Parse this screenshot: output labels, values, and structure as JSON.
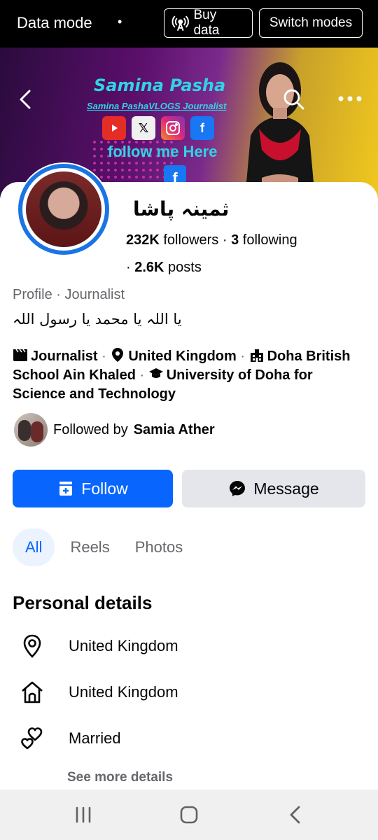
{
  "status_bar": {
    "mode_label": "Data mode",
    "buy_data_label": "Buy data",
    "switch_modes_label": "Switch modes"
  },
  "cover": {
    "title": "Samina Pasha",
    "subtitle": "Samina PashaVLOGS Journalist",
    "follow_text": "follow me Here",
    "social_icons": [
      "youtube-icon",
      "x-icon",
      "instagram-icon",
      "facebook-icon"
    ]
  },
  "profile": {
    "name": "ثمینہ پاشا",
    "followers_count": "232K",
    "followers_label": "followers",
    "following_count": "3",
    "following_label": "following",
    "posts_count": "2.6K",
    "posts_label": "posts",
    "category": "Profile · Journalist",
    "bio": "یا اللہ یا محمد یا رسول اللہ",
    "details": {
      "job": "Journalist",
      "location": "United Kingdom",
      "school_part1": "Doha British",
      "school_part2": "School Ain Khaled",
      "university_part1": "University of Doha for",
      "university_part2": "Science and Technology"
    },
    "followed_by_label": "Followed by",
    "followed_by_name": "Samia Ather"
  },
  "actions": {
    "follow_label": "Follow",
    "message_label": "Message"
  },
  "tabs": [
    {
      "label": "All",
      "active": true
    },
    {
      "label": "Reels",
      "active": false
    },
    {
      "label": "Photos",
      "active": false
    }
  ],
  "personal_details": {
    "title": "Personal details",
    "items": [
      {
        "icon": "location-pin-icon",
        "text": "United Kingdom"
      },
      {
        "icon": "home-icon",
        "text": "United Kingdom"
      },
      {
        "icon": "hearts-icon",
        "text": "Married"
      }
    ],
    "see_more_label": "See more details"
  },
  "colors": {
    "accent": "#0866ff",
    "secondary_button": "#e4e6eb",
    "muted_text": "#65676b",
    "avatar_ring": "#1b74e4"
  }
}
